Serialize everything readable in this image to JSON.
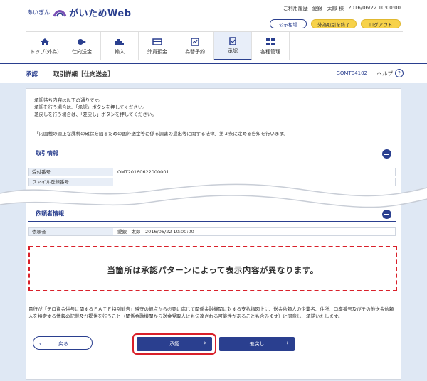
{
  "header": {
    "brand_small": "あいぎん",
    "brand": "がいためWeb",
    "help_link": "ご利用履歴",
    "user": "愛銀　太郎 様",
    "datetime": "2016/06/22 10:00:00",
    "btn_public": "公示相場",
    "btn_exit": "外為取引を終了",
    "btn_logout": "ログアウト"
  },
  "nav": [
    {
      "label": "トップ(外為)",
      "icon": "home-icon"
    },
    {
      "label": "仕向送金",
      "icon": "remit-icon"
    },
    {
      "label": "輸入",
      "icon": "import-icon"
    },
    {
      "label": "外貨預金",
      "icon": "deposit-icon"
    },
    {
      "label": "為替予約",
      "icon": "reserve-icon"
    },
    {
      "label": "承認",
      "icon": "approval-icon"
    },
    {
      "label": "各種管理",
      "icon": "manage-icon"
    }
  ],
  "page": {
    "section": "承認",
    "title": "取引詳細［仕向送金］",
    "code": "GOMT04102",
    "help": "ヘルプ"
  },
  "intro": [
    "承認待ち内容は以下の通りです。",
    "承認を行う場合は、「承認」ボタンを押してください。",
    "差戻しを行う場合は、「差戻し」ボタンを押してください。"
  ],
  "notice": "「内国税の適正な課税の確保を図るための国外送金等に係る調書の提出等に関する法律」第３条に定める告知を行います。",
  "section1": {
    "title": "取引情報",
    "rows": [
      {
        "key": "受付番号",
        "value": "OMT20160622000001"
      },
      {
        "key": "ファイル登録番号",
        "value": ""
      }
    ]
  },
  "section2": {
    "title": "依頼者情報",
    "rows": [
      {
        "key": "依頼者",
        "value": "愛銀　太郎　2016/06/22 10:00:00"
      }
    ]
  },
  "pattern_message": "当箇所は承認パターンによって表示内容が異なります。",
  "bottom_text": "貴行が「テロ資金供与に関するＦＡＴＦ特別勧告」遵守の観点から必要に応じて関係金融機関に対する支払指図上に、送金依頼人の企業名、住所、口座番号及びその他送金依頼人を特定する情報の記載及び提供を行うこと（関係金融機関から送金受取人にも伝達される可能性があることも含みます）に同意し、承諾いたします。",
  "buttons": {
    "back": "戻る",
    "approve": "承認",
    "reject": "差戻し"
  }
}
